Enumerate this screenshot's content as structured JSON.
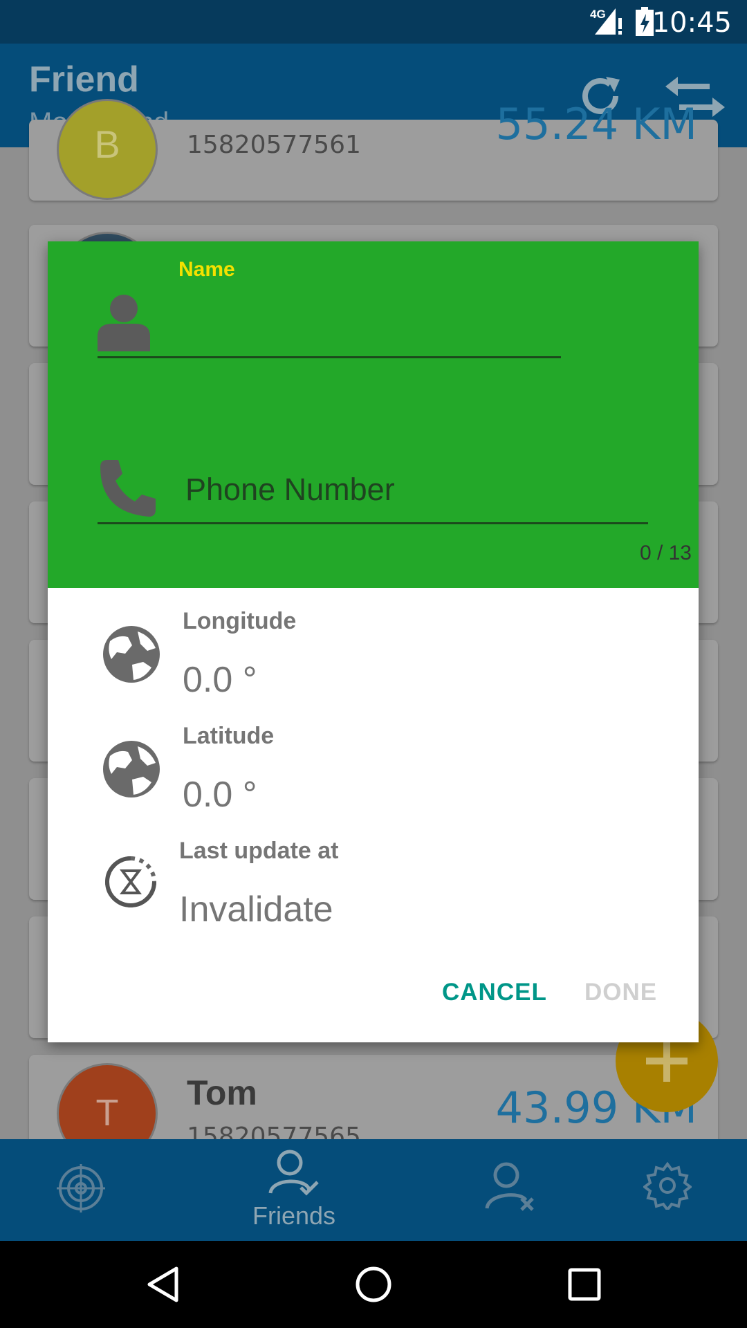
{
  "status_bar": {
    "network": "4G",
    "time": "10:45"
  },
  "app_bar": {
    "title": "Friend",
    "subtitle": "More friend",
    "icons": [
      "refresh-icon",
      "swap-icon"
    ]
  },
  "friends": [
    {
      "initial": "B",
      "phone": "15820577561",
      "distance": "55.24 KM",
      "avatar_color": "#a3a02a"
    },
    {
      "initial": "T",
      "name": "Tom",
      "phone": "15820577565",
      "distance": "43.99 KM",
      "avatar_color": "#a0401c"
    }
  ],
  "dialog": {
    "name_label": "Name",
    "name_value": "",
    "phone_placeholder": "Phone Number",
    "char_counter": "0 / 13",
    "longitude_label": "Longitude",
    "longitude_value": "0.0 °",
    "latitude_label": "Latitude",
    "latitude_value": "0.0 °",
    "last_update_label": "Last update at",
    "last_update_value": "Invalidate",
    "cancel_label": "CANCEL",
    "done_label": "DONE"
  },
  "bottom_nav": {
    "items": [
      {
        "icon": "radar-icon",
        "label": ""
      },
      {
        "icon": "friends-icon",
        "label": "Friends"
      },
      {
        "icon": "remove-user-icon",
        "label": ""
      },
      {
        "icon": "settings-icon",
        "label": ""
      }
    ]
  },
  "colors": {
    "primary": "#054d7a",
    "dialog_header": "#23a829",
    "accent_text": "#009688",
    "name_label": "#f4e100"
  }
}
